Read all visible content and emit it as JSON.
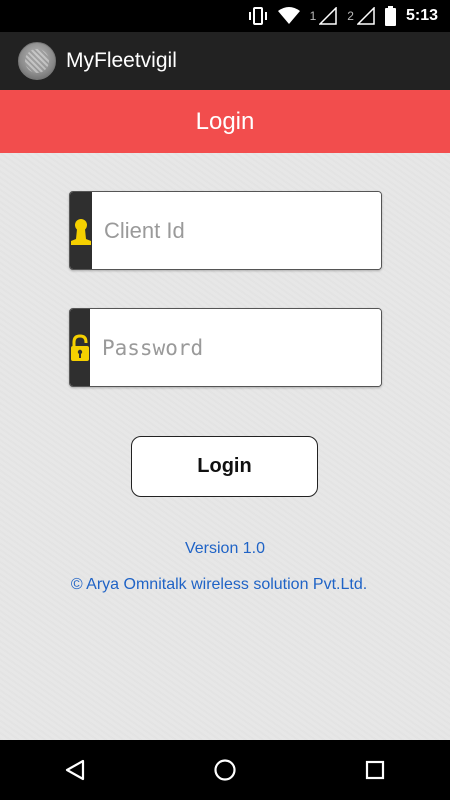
{
  "status_bar": {
    "time": "5:13",
    "sim1_label": "1",
    "sim2_label": "2",
    "icons": [
      "vibrate-icon",
      "wifi-icon",
      "signal-icon",
      "signal-icon",
      "battery-icon"
    ]
  },
  "app_bar": {
    "title": "MyFleetvigil"
  },
  "header": {
    "title": "Login"
  },
  "form": {
    "client_id": {
      "placeholder": "Client Id",
      "value": "",
      "icon": "user-icon"
    },
    "password": {
      "placeholder": "Password",
      "value": "",
      "icon": "lock-icon"
    },
    "login_label": "Login"
  },
  "footer": {
    "version": "Version 1.0",
    "copyright": "© Arya Omnitalk wireless solution Pvt.Ltd."
  },
  "nav_bar": {
    "icons": [
      "back-icon",
      "home-icon",
      "recents-icon"
    ]
  },
  "colors": {
    "header_bg": "#f24d4d",
    "app_bar_bg": "#222222",
    "link_blue": "#1f63c6",
    "icon_yellow": "#f5d000"
  }
}
